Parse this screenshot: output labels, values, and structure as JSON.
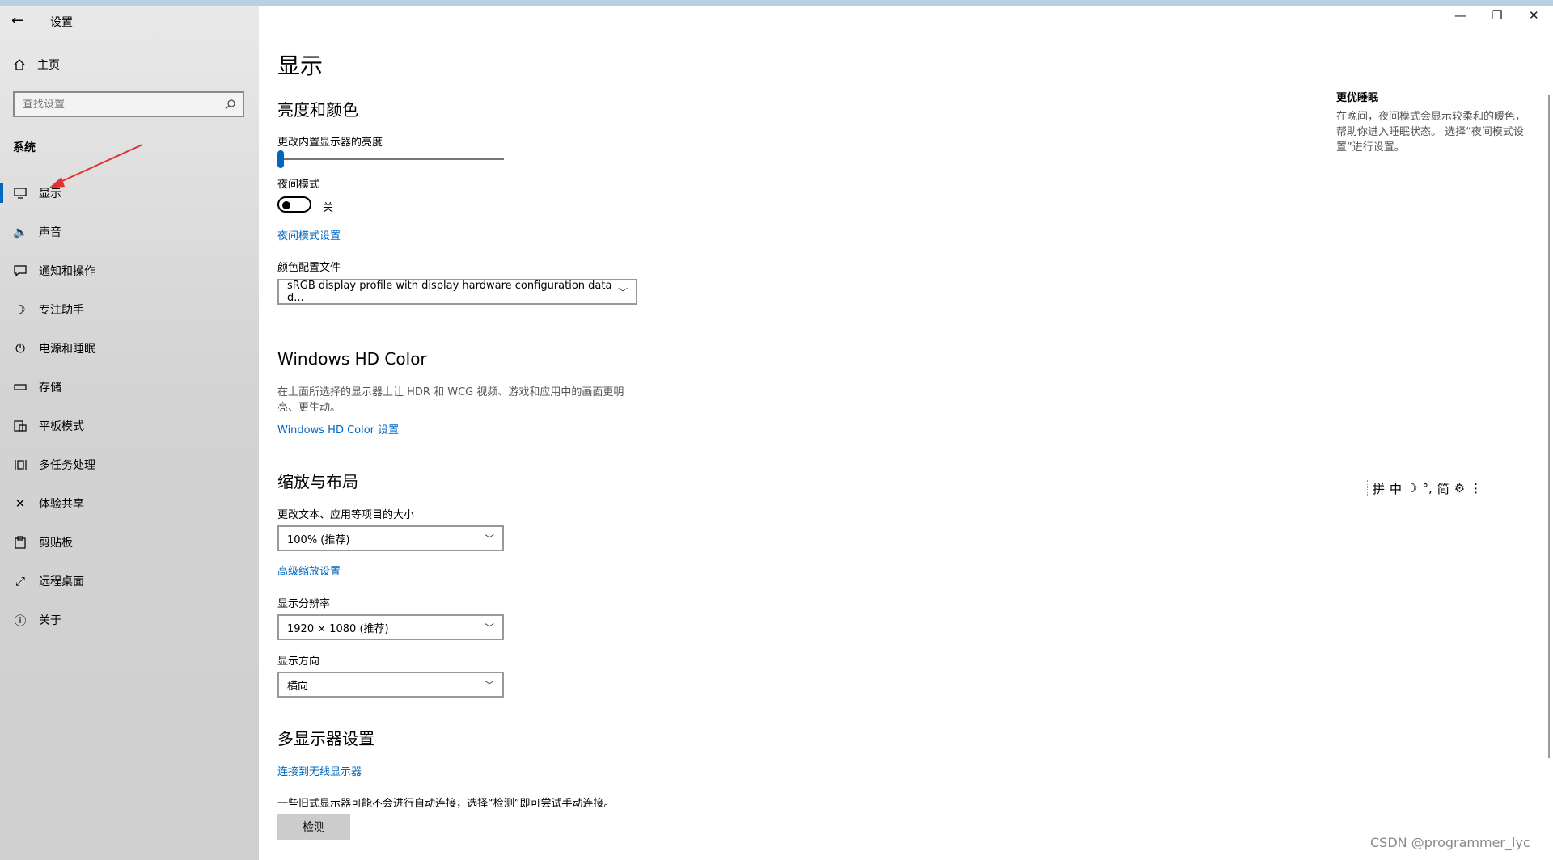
{
  "window": {
    "title": "设置",
    "back_icon": "←",
    "minimize": "—",
    "restore": "❐",
    "close": "✕"
  },
  "sidebar": {
    "home_label": "主页",
    "search_placeholder": "查找设置",
    "section": "系统",
    "items": [
      {
        "label": "显示",
        "icon": "display-icon",
        "active": true
      },
      {
        "label": "声音",
        "icon": "speaker-icon"
      },
      {
        "label": "通知和操作",
        "icon": "notification-icon"
      },
      {
        "label": "专注助手",
        "icon": "moon-icon"
      },
      {
        "label": "电源和睡眠",
        "icon": "power-icon"
      },
      {
        "label": "存储",
        "icon": "storage-icon"
      },
      {
        "label": "平板模式",
        "icon": "tablet-icon"
      },
      {
        "label": "多任务处理",
        "icon": "multitask-icon"
      },
      {
        "label": "体验共享",
        "icon": "share-icon"
      },
      {
        "label": "剪贴板",
        "icon": "clipboard-icon"
      },
      {
        "label": "远程桌面",
        "icon": "remote-icon"
      },
      {
        "label": "关于",
        "icon": "info-icon"
      }
    ]
  },
  "main": {
    "page_title": "显示",
    "brightness": {
      "heading": "亮度和颜色",
      "label": "更改内置显示器的亮度",
      "value": 0
    },
    "night": {
      "label": "夜间模式",
      "state": "关",
      "settings_link": "夜间模式设置"
    },
    "color_profile": {
      "label": "颜色配置文件",
      "value": "sRGB display profile with display hardware configuration data d..."
    },
    "hdr": {
      "heading": "Windows HD Color",
      "desc": "在上面所选择的显示器上让 HDR 和 WCG 视频、游戏和应用中的画面更明亮、更生动。",
      "link": "Windows HD Color 设置"
    },
    "scale": {
      "heading": "缩放与布局",
      "size_label": "更改文本、应用等项目的大小",
      "size_value": "100% (推荐)",
      "advanced_link": "高级缩放设置",
      "resolution_label": "显示分辨率",
      "resolution_value": "1920 × 1080 (推荐)",
      "orientation_label": "显示方向",
      "orientation_value": "横向"
    },
    "multi": {
      "heading": "多显示器设置",
      "wireless_link": "连接到无线显示器",
      "detect_desc": "一些旧式显示器可能不会进行自动连接，选择“检测”即可尝试手动连接。",
      "detect_button": "检测"
    }
  },
  "aside": {
    "title": "更优睡眠",
    "desc": "在晚间，夜间模式会显示较柔和的暖色，帮助你进入睡眠状态。 选择“夜间模式设置”进行设置。"
  },
  "ime": [
    "拼",
    "中",
    "☽",
    "°,",
    "简",
    "⚙",
    "⋮"
  ],
  "watermark": "CSDN @programmer_lyc",
  "colors": {
    "accent": "#0067c0",
    "annotation_arrow": "#e53030"
  }
}
